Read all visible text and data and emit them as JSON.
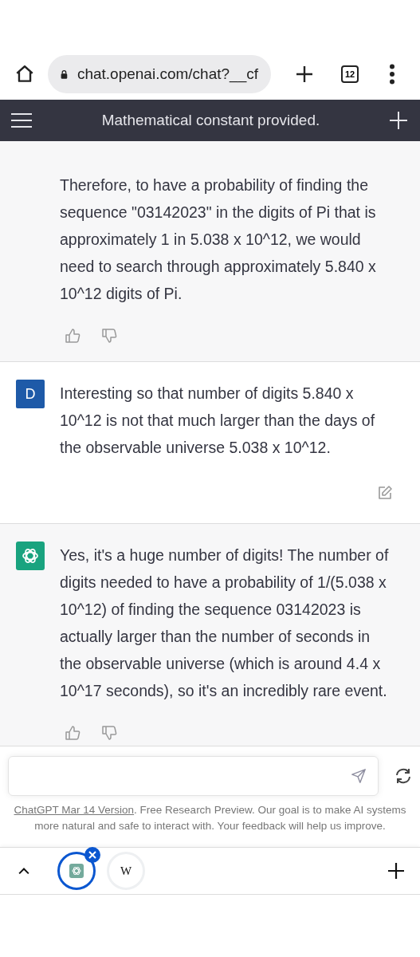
{
  "browser": {
    "url": "chat.openai.com/chat?__cf",
    "tab_count": "12"
  },
  "header": {
    "title": "Mathematical constant provided."
  },
  "messages": [
    {
      "kind": "assistant",
      "text": "Therefore, to have a probability of finding the sequence \"03142023\" in the digits of Pi that is approximately 1 in 5.038 x 10^12, we would need to search through approximately 5.840 x 10^12 digits of Pi."
    },
    {
      "kind": "user",
      "avatar": "D",
      "text": "Interesting so that number of digits 5.840 x 10^12 is not that much larger than the days of the observable universe 5.038 x 10^12."
    },
    {
      "kind": "assistant",
      "text": "Yes, it's a huge number of digits! The number of digits needed to have a probability of 1/(5.038 x 10^12) of finding the sequence 03142023 is actually larger than the number of seconds in the observable universe (which is around 4.4 x 10^17 seconds), so it's an incredibly rare event."
    }
  ],
  "footer": {
    "link": "ChatGPT Mar 14 Version",
    "text": ". Free Research Preview. Our goal is to make AI systems more natural and safe to interact with. Your feedback will help us improve."
  },
  "tabs": [
    {
      "kind": "chatgpt",
      "selected": true
    },
    {
      "kind": "wiki",
      "label": "W",
      "selected": false
    }
  ]
}
